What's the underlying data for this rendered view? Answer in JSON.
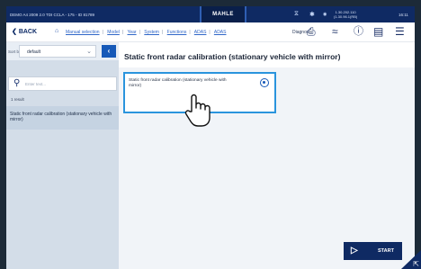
{
  "topbar": {
    "vehicle_info": "DEMO A4 2009 2.0 TDI CCLA - 175 - ID 81789",
    "brand": "MAHLE",
    "ip_line1": "1.30.202.110",
    "ip_line2": "(1.30.96.1(RB)",
    "time": "16:11"
  },
  "nav": {
    "back_label": "BACK",
    "breadcrumbs": [
      "Manual selection",
      "Model",
      "Year",
      "System",
      "Functions",
      "ADAS",
      "ADAS"
    ],
    "diagnosis_label": "Diagnosis"
  },
  "sidebar": {
    "sort_by_label": "Sort by:",
    "sort_value": "default",
    "search_placeholder": "Enter text...",
    "result_count": "1 result",
    "result_item": "Static front radar calibration (stationary vehicle with mirror)"
  },
  "main": {
    "title": "Static front radar calibration (stationary vehicle with mirror)",
    "option_label": "Static front radar calibration (stationary vehicle with mirror)",
    "start_label": "START"
  },
  "colors": {
    "topbar": "#0f2a63",
    "accent": "#1659b8",
    "selection_border": "#2a94dd",
    "sidebar": "#d3dde8"
  }
}
